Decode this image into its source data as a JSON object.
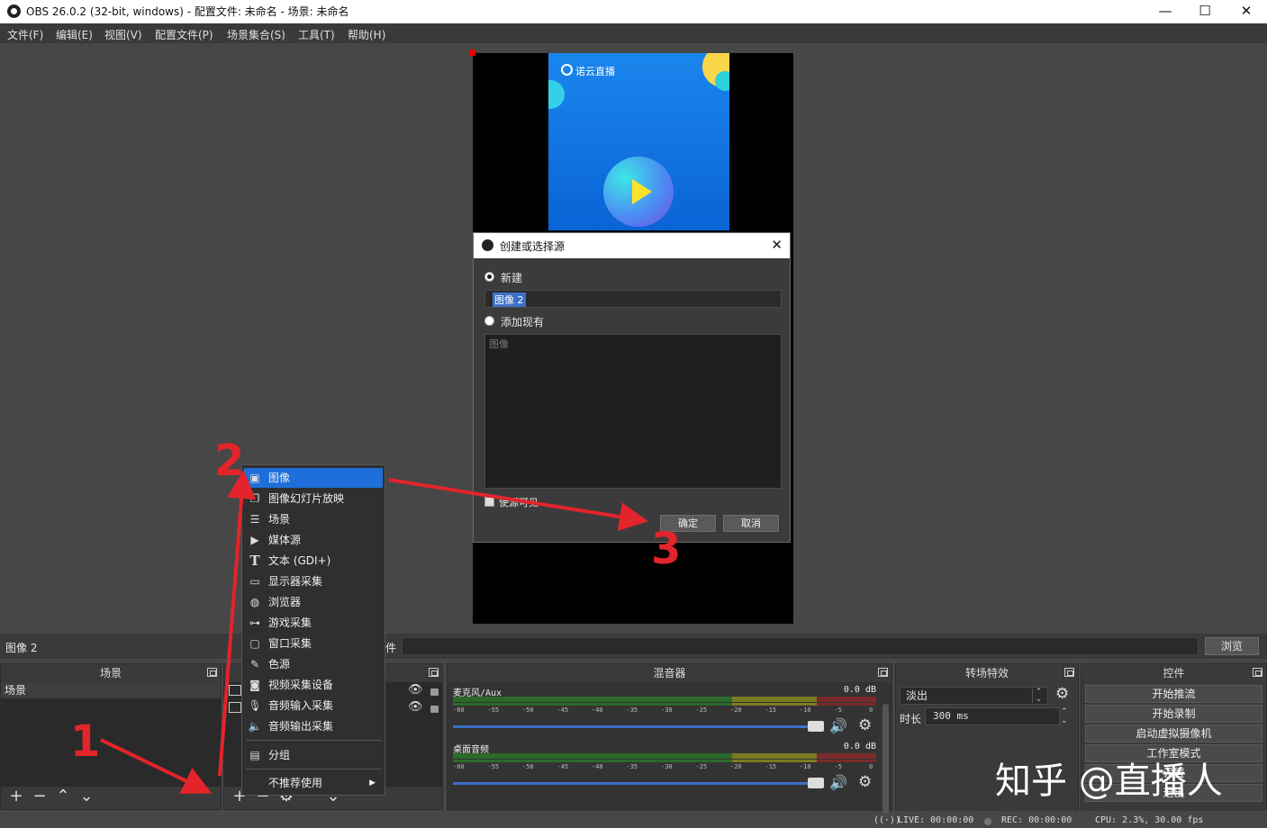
{
  "window": {
    "title": "OBS 26.0.2 (32-bit, windows) - 配置文件: 未命名 - 场景: 未命名",
    "minimize": "—",
    "maximize": "☐",
    "close": "✕"
  },
  "menubar": [
    "文件(F)",
    "编辑(E)",
    "视图(V)",
    "配置文件(P)",
    "场景集合(S)",
    "工具(T)",
    "帮助(H)"
  ],
  "preview": {
    "brand": "诺云直播"
  },
  "dialog": {
    "title": "创建或选择源",
    "close": "✕",
    "new_label": "新建",
    "name_value": "图像 2",
    "add_existing_label": "添加现有",
    "list_placeholder": "图像",
    "visible_label": "使源可见",
    "ok": "确定",
    "cancel": "取消"
  },
  "source_bar": {
    "current": "图像 2",
    "filter_suffix": "件",
    "browse": "浏览"
  },
  "docks": {
    "scenes": {
      "title": "场景",
      "items": [
        "场景"
      ]
    },
    "sources": {
      "title": ""
    },
    "mixer": {
      "title": "混音器",
      "channels": [
        {
          "name": "麦克风/Aux",
          "db": "0.0 dB"
        },
        {
          "name": "桌面音频",
          "db": "0.0 dB"
        }
      ],
      "ticks": [
        "-60",
        "-55",
        "-50",
        "-45",
        "-40",
        "-35",
        "-30",
        "-25",
        "-20",
        "-15",
        "-10",
        "-5",
        "0"
      ]
    },
    "transitions": {
      "title": "转场特效",
      "selected": "淡出",
      "duration_label": "时长",
      "duration_value": "300 ms"
    },
    "controls": {
      "title": "控件",
      "buttons": [
        "开始推流",
        "开始录制",
        "启动虚拟摄像机",
        "工作室模式",
        "设置",
        "退出"
      ]
    }
  },
  "context_menu": {
    "items": [
      {
        "label": "图像",
        "icon": "image-icon"
      },
      {
        "label": "图像幻灯片放映",
        "icon": "slideshow-icon"
      },
      {
        "label": "场景",
        "icon": "list-icon"
      },
      {
        "label": "媒体源",
        "icon": "play-icon"
      },
      {
        "label": "文本 (GDI+)",
        "icon": "text-icon"
      },
      {
        "label": "显示器采集",
        "icon": "monitor-icon"
      },
      {
        "label": "浏览器",
        "icon": "globe-icon"
      },
      {
        "label": "游戏采集",
        "icon": "gamepad-icon"
      },
      {
        "label": "窗口采集",
        "icon": "window-icon"
      },
      {
        "label": "色源",
        "icon": "brush-icon"
      },
      {
        "label": "视频采集设备",
        "icon": "camera-icon"
      },
      {
        "label": "音频输入采集",
        "icon": "microphone-icon"
      },
      {
        "label": "音频输出采集",
        "icon": "speaker-icon"
      }
    ],
    "group": "分组",
    "deprecated": "不推荐使用",
    "deprecated_arrow": "▶",
    "selected_index": 0
  },
  "status": {
    "live": "LIVE: 00:00:00",
    "rec": "REC: 00:00:00",
    "cpu": "CPU: 2.3%, 30.00 fps"
  },
  "annotations": [
    "1",
    "2",
    "3"
  ],
  "watermark": "知乎 @直播人",
  "colors": {
    "accent": "#1e6fd9",
    "arrow": "#e3242b",
    "background": "#474747"
  }
}
